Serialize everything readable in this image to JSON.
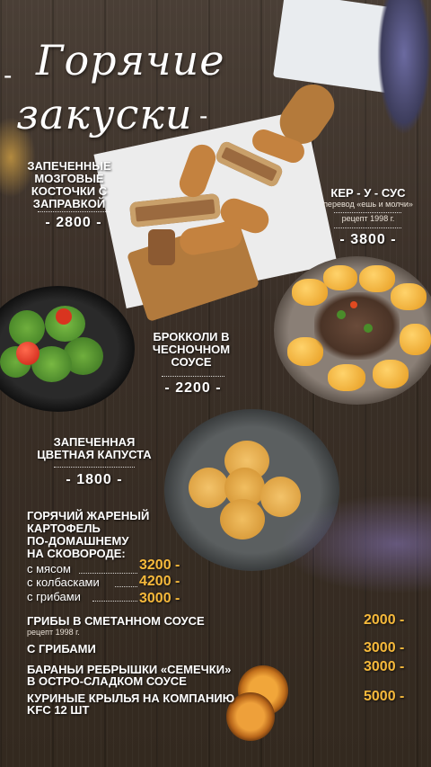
{
  "title": {
    "line1": "Горячие",
    "line2": "закуски",
    "dash_left": "-",
    "dash_right": "-"
  },
  "items": [
    {
      "id": "marrow",
      "name": "ЗАПЕЧЕННЫЕ МОЗГОВЫЕ КОСТОЧКИ С ЗАПРАВКОЙ",
      "price": "- 2800 -"
    },
    {
      "id": "kerusus",
      "name": "КЕР - У - СУС",
      "note": "перевод «ешь и молчи»",
      "recipe": "рецепт 1998 г.",
      "price": "- 3800 -"
    },
    {
      "id": "broccoli",
      "name": "БРОККОЛИ В ЧЕСНОЧНОМ СОУСЕ",
      "price": "- 2200 -"
    },
    {
      "id": "cauliflower",
      "name": "ЗАПЕЧЕННАЯ ЦВЕТНАЯ КАПУСТА",
      "price": "- 1800 -"
    }
  ],
  "potato": {
    "title_lines": [
      "ГОРЯЧИЙ ЖАРЕНЫЙ",
      "КАРТОФЕЛЬ",
      "ПО-ДОМАШНЕМУ",
      "НА СКОВОРОДЕ:"
    ],
    "options": [
      {
        "label": "с мясом",
        "price": "3200 -"
      },
      {
        "label": "с колбасками",
        "price": "4200 -"
      },
      {
        "label": "с грибами",
        "price": "3000 -"
      }
    ]
  },
  "bottom": [
    {
      "name": "ГРИБЫ В СМЕТАННОМ СОУСЕ",
      "sub": "рецепт 1998 г.",
      "price": "2000 -"
    },
    {
      "name": "С ГРИБАМИ",
      "price": "3000 -"
    },
    {
      "name": "БАРАНЬИ РЕБРЫШКИ «СЕМЕЧКИ»",
      "name2": "В ОСТРО-СЛАДКОМ СОУСЕ",
      "price": "3000 -"
    },
    {
      "name": "КУРИНЫЕ КРЫЛЬЯ НА КОМПАНИЮ",
      "name2": "KFC 12 ШТ",
      "price": "5000 -"
    }
  ],
  "colors": {
    "price_accent": "#f6b93b",
    "background": "#3e332a"
  }
}
